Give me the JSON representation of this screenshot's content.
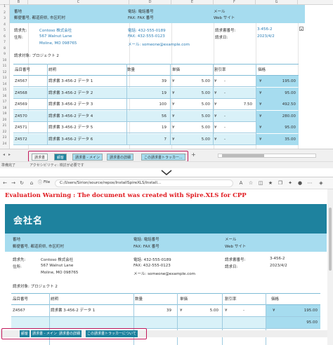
{
  "excel": {
    "columns": [
      "B",
      "C",
      "D",
      "E",
      "F",
      "G"
    ],
    "rows": [
      "1",
      "2",
      "3",
      "4",
      "5",
      "6",
      "7",
      "8",
      "9",
      "10",
      "11",
      "12",
      "13",
      "14",
      "15",
      "16",
      "17",
      "18",
      "19",
      "20",
      "21",
      "22",
      "23",
      "24"
    ],
    "header": {
      "address_label": "番地",
      "address_value": "郵便番号, 都道府県, 市区町村",
      "phone_label": "電話: 電話番号",
      "fax_label": "FAX: FAX 番号",
      "mail_label": "メール",
      "web_label": "Web サイト"
    },
    "billing": {
      "to_label": "請求先:",
      "to_value": "Contoso 株式会社",
      "address_label": "住所:",
      "street": "567 Walnut Lane",
      "city": "Moline, MO 098765",
      "phone": "電話: 432-555-0189",
      "fax": "FAX: 432-555-0123",
      "email": "メール: someone@example.com",
      "invoice_no_label": "請求書番号:",
      "invoice_no": "3-456-2",
      "invoice_date_label": "請求日:",
      "invoice_date": "2023/4/2"
    },
    "project": "請求対象: プロジェクト 2",
    "table": {
      "headers": [
        "品目番号",
        "説明",
        "数量",
        "単価",
        "割引率",
        "価格"
      ],
      "rows": [
        {
          "id": "Z4567",
          "desc": "請求書 3-456-2 データ 1",
          "qty": "39",
          "cur": "¥",
          "price": "5.00",
          "disc_cur": "¥",
          "disc": "-",
          "total_cur": "¥",
          "total": "195.00"
        },
        {
          "id": "Z4568",
          "desc": "請求書 3-456-2 データ 2",
          "qty": "19",
          "cur": "¥",
          "price": "5.00",
          "disc_cur": "¥",
          "disc": "-",
          "total_cur": "¥",
          "total": "95.00"
        },
        {
          "id": "Z4569",
          "desc": "請求書 3-456-2 データ 3",
          "qty": "100",
          "cur": "¥",
          "price": "5.00",
          "disc_cur": "¥",
          "disc": "7.50",
          "total_cur": "¥",
          "total": "492.50"
        },
        {
          "id": "Z4570",
          "desc": "請求書 3-456-2 データ 4",
          "qty": "56",
          "cur": "¥",
          "price": "5.00",
          "disc_cur": "¥",
          "disc": "-",
          "total_cur": "¥",
          "total": "280.00"
        },
        {
          "id": "Z4571",
          "desc": "請求書 3-456-2 データ 5",
          "qty": "19",
          "cur": "¥",
          "price": "5.00",
          "disc_cur": "¥",
          "disc": "-",
          "total_cur": "¥",
          "total": "95.00"
        },
        {
          "id": "Z4572",
          "desc": "請求書 3-456-2 データ 6",
          "qty": "7",
          "cur": "¥",
          "price": "5.00",
          "disc_cur": "¥",
          "disc": "-",
          "total_cur": "¥",
          "total": "35.00"
        }
      ]
    },
    "tabs": [
      "請求書",
      "顧客",
      "請求書 - メイン",
      "請求書の詳細",
      "この請求書トラッカー..."
    ],
    "add_sheet": "+",
    "tab_more": "⋯",
    "status_ready": "準備完了",
    "status_accessibility": "アクセシビリティ: 検討が必要です"
  },
  "browser": {
    "info_label": "File",
    "url": "C:/Users/Sirion/source/repos/InstallSpireXLS/Install...",
    "warning": "Evaluation Warning : The document was created with  Spire.XLS for CPP",
    "company": "会社名",
    "header": {
      "address_label": "番地",
      "address_value": "郵便番号, 都道府県, 市区町村",
      "phone_label": "電話: 電話番号",
      "fax_label": "FAX: FAX 番号",
      "mail_label": "メール",
      "web_label": "Web サイト"
    },
    "billing": {
      "to_label": "請求先:",
      "to_value": "Contoso 株式会社",
      "address_label": "住所:",
      "street": "567 Walnut Lane",
      "city": "Moline, MO 098765",
      "phone": "電話: 432-555-0189",
      "fax": "FAX: 432-555-0123",
      "email": "メール: someone@example.com",
      "invoice_no_label": "請求書番号:",
      "invoice_no": "3-456-2",
      "invoice_date_label": "請求日:",
      "invoice_date": "2023/4/2"
    },
    "project": "請求対象: プロジェクト 2",
    "table_headers": [
      "品目番号",
      "説明",
      "数量",
      "単価",
      "割引率",
      "価格"
    ],
    "row1": {
      "id": "Z4567",
      "desc": "請求書 3-456-2 データ 1",
      "qty": "39",
      "cur": "¥",
      "price": "5.00",
      "disc_cur": "¥",
      "disc": "-",
      "total_cur": "¥",
      "total": "195.00"
    },
    "row2": {
      "total": "95.00"
    },
    "tabs": [
      "顧客",
      "請求書 - メイン",
      "請求書の詳細",
      "この請求書トラッカーについて"
    ]
  },
  "colors": {
    "accent_dark": "#1e829e",
    "accent_light": "#a6dcef",
    "row_alt": "#d9f1f8",
    "warning_red": "#e0191f",
    "highlight_box": "#c2185b"
  }
}
